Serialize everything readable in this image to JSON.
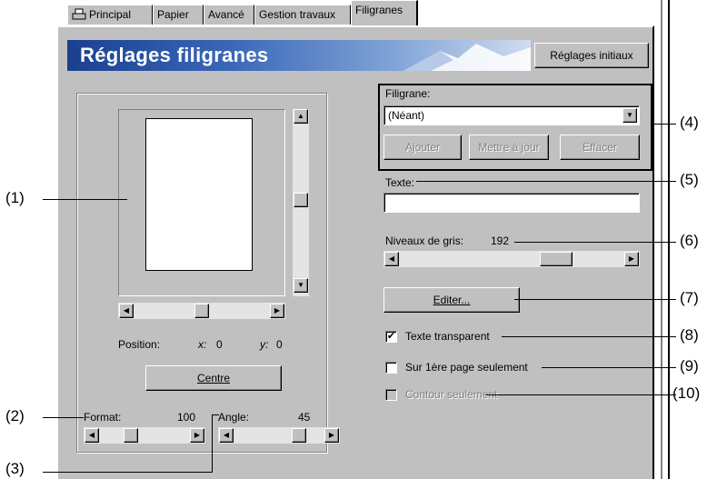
{
  "tabs": [
    {
      "label": "Principal"
    },
    {
      "label": "Papier"
    },
    {
      "label": "Avancé"
    },
    {
      "label": "Gestion travaux"
    },
    {
      "label": "Filigranes"
    }
  ],
  "banner": {
    "title": "Réglages filigranes",
    "reset_button": "Réglages initiaux"
  },
  "preview": {
    "position_label": "Position:",
    "x_label": "x:",
    "x_value": "0",
    "y_label": "y:",
    "y_value": "0",
    "center_button": "Centre",
    "format_label": "Format:",
    "format_value": "100",
    "angle_label": "Angle:",
    "angle_value": "45"
  },
  "watermark": {
    "label": "Filigrane:",
    "selected": "(Néant)",
    "add_button": "Ajouter",
    "update_button": "Mettre à jour",
    "delete_button": "Effacer"
  },
  "text_field": {
    "label": "Texte:",
    "value": ""
  },
  "gray": {
    "label": "Niveaux de gris:",
    "value": "192",
    "level": 0.75
  },
  "edit_button": "Editer...",
  "options": {
    "transparent": {
      "label": "Texte transparent",
      "checked": true
    },
    "first_page": {
      "label": "Sur 1ère page seulement",
      "checked": false
    },
    "outline": {
      "label": "Contour seulement",
      "checked": false,
      "disabled": true
    }
  },
  "callouts": [
    "(1)",
    "(2)",
    "(3)",
    "(4)",
    "(5)",
    "(6)",
    "(7)",
    "(8)",
    "(9)",
    "(10)"
  ]
}
